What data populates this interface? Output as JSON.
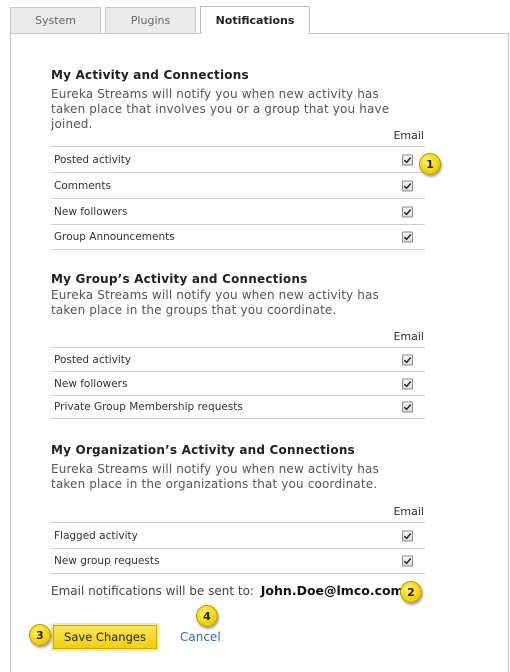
{
  "tabs": {
    "system": "System",
    "plugins": "Plugins",
    "notifications": "Notifications"
  },
  "sections": [
    {
      "title": "My Activity and Connections",
      "description": "Eureka Streams will notify you when new activity has taken place that involves you or a group that you have joined.",
      "email_header": "Email",
      "rows": [
        {
          "label": "Posted activity",
          "email_checked": true
        },
        {
          "label": "Comments",
          "email_checked": true
        },
        {
          "label": "New followers",
          "email_checked": true
        },
        {
          "label": "Group Announcements",
          "email_checked": true
        }
      ]
    },
    {
      "title": "My Group’s Activity and Connections",
      "description": "Eureka Streams will notify you when new activity has taken place in the groups that you coordinate.",
      "email_header": "Email",
      "rows": [
        {
          "label": "Posted activity",
          "email_checked": true
        },
        {
          "label": "New followers",
          "email_checked": true
        },
        {
          "label": "Private Group Membership requests",
          "email_checked": true
        }
      ]
    },
    {
      "title": "My Organization’s Activity and Connections",
      "description": "Eureka Streams will notify you when new activity has taken place in the organizations that you coordinate.",
      "email_header": "Email",
      "rows": [
        {
          "label": "Flagged activity",
          "email_checked": true
        },
        {
          "label": "New group requests",
          "email_checked": true
        }
      ]
    }
  ],
  "email_notice": {
    "text": "Email notifications will be sent to:",
    "address": "John.Doe@lmco.com"
  },
  "actions": {
    "save_label": "Save Changes",
    "cancel_label": "Cancel"
  },
  "callouts": [
    "1",
    "2",
    "3",
    "4"
  ],
  "colors": {
    "accent_button": "#f0cf10",
    "callout": "#f2d100",
    "link": "#2a6fb5"
  }
}
